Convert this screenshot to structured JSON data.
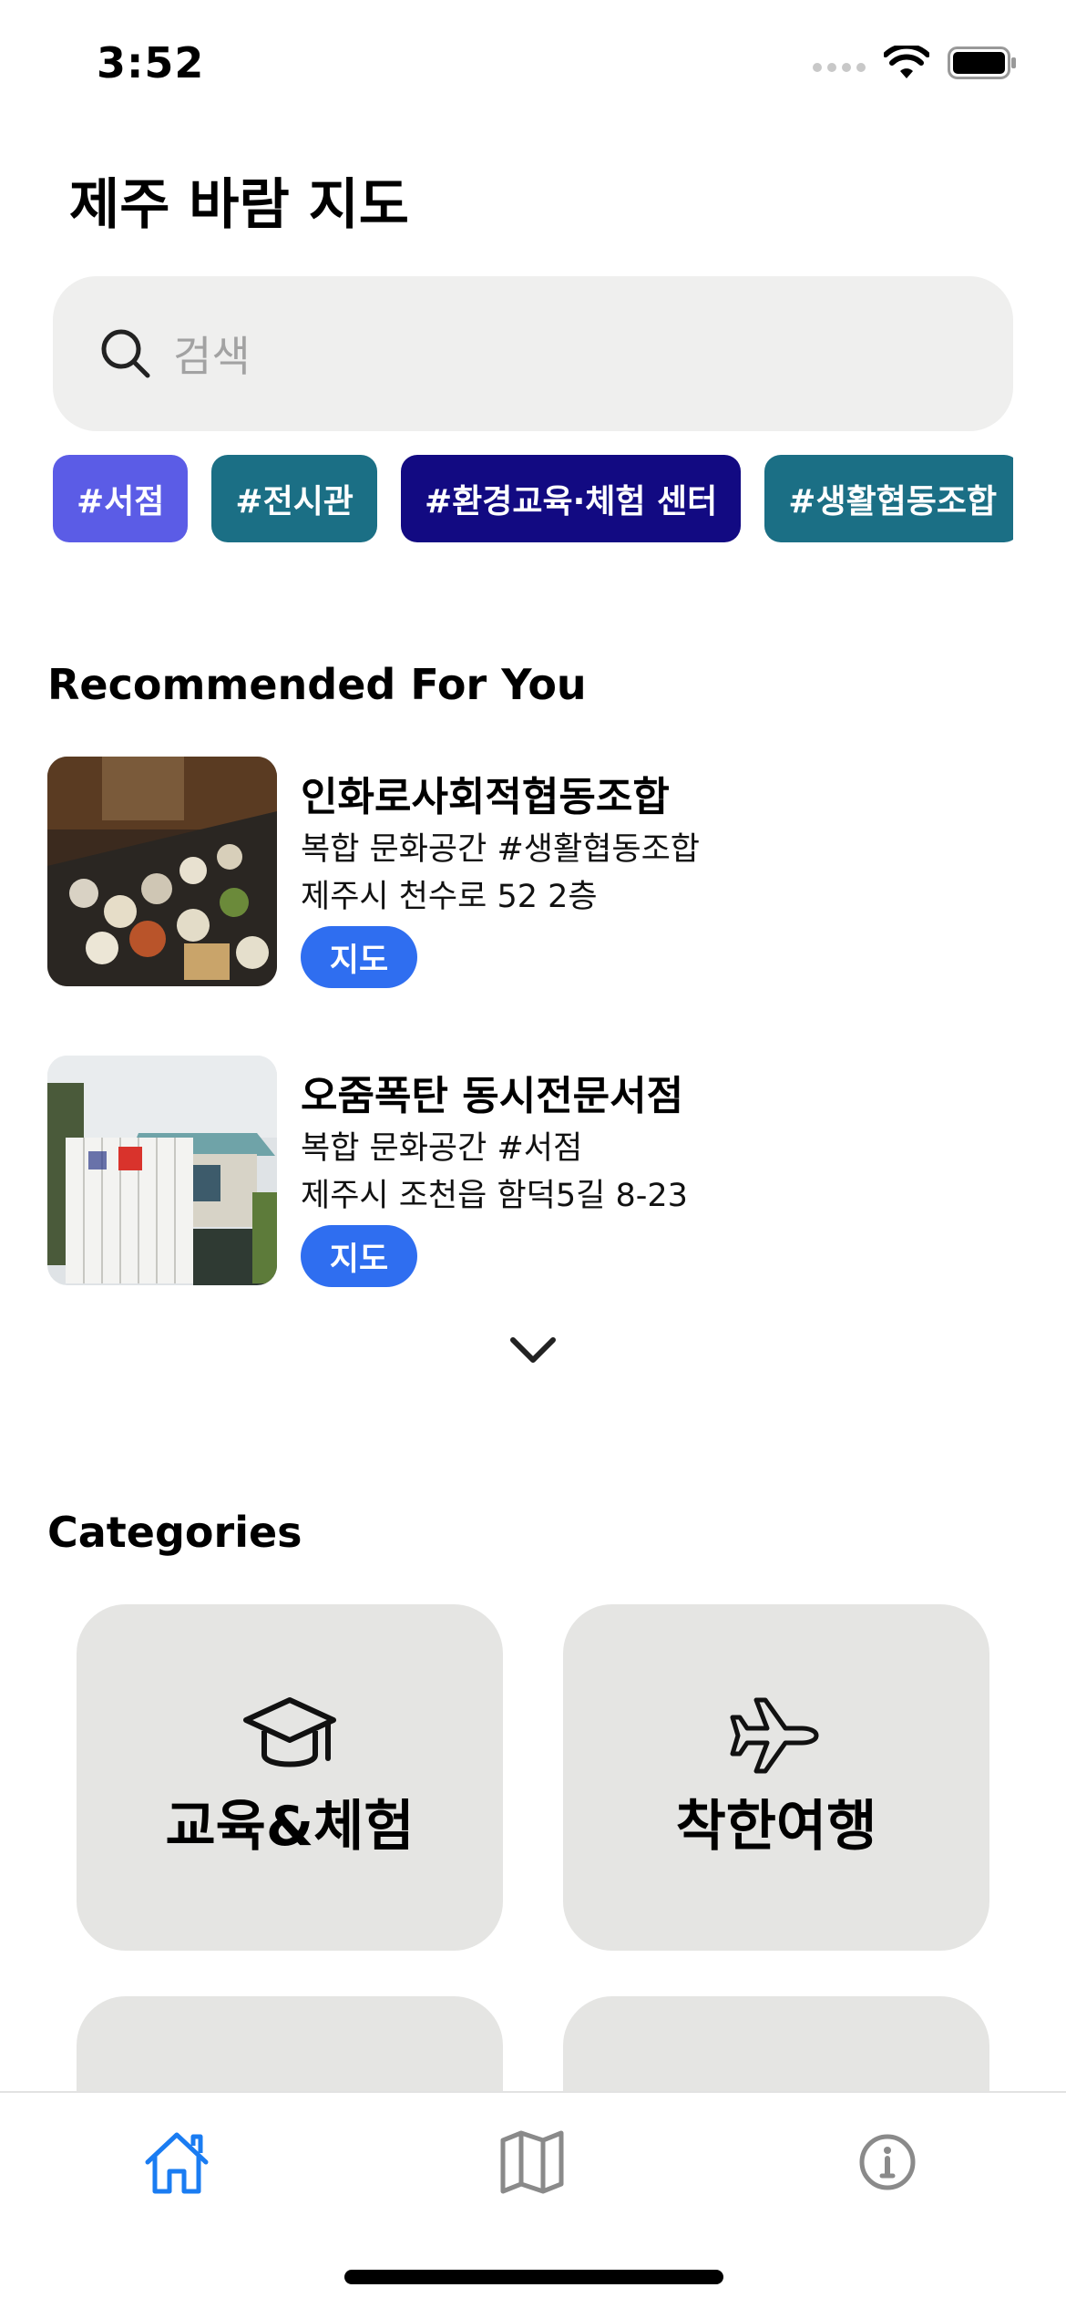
{
  "status_bar": {
    "time": "3:52"
  },
  "app_title": "제주 바람 지도",
  "search": {
    "placeholder": "검색"
  },
  "chips": [
    {
      "label": "#서점",
      "color": "#5b5ce6"
    },
    {
      "label": "#전시관",
      "color": "#1b6f85"
    },
    {
      "label": "#환경교육·체험 센터",
      "color": "#120a82"
    },
    {
      "label": "#생활협동조합",
      "color": "#1b6f85"
    }
  ],
  "recommended": {
    "title": "Recommended For You",
    "items": [
      {
        "name": "인화로사회적협동조합",
        "category": "복합 문화공간 #생활협동조합",
        "address": "제주시 천수로 52 2층",
        "button": "지도"
      },
      {
        "name": "오줌폭탄 동시전문서점",
        "category": "복합 문화공간 #서점",
        "address": "제주시 조천읍 함덕5길 8-23",
        "button": "지도"
      }
    ]
  },
  "categories": {
    "title": "Categories",
    "items": [
      {
        "label": "교육&체험",
        "icon": "graduation-cap-icon"
      },
      {
        "label": "착한여행",
        "icon": "airplane-icon"
      }
    ]
  },
  "tab_bar": {
    "tabs": [
      {
        "icon": "home-icon",
        "active": true
      },
      {
        "icon": "map-icon",
        "active": false
      },
      {
        "icon": "info-icon",
        "active": false
      }
    ]
  },
  "colors": {
    "accent": "#2f6ef0",
    "active_tab": "#1a7cf2",
    "card_bg": "#e5e5e3"
  }
}
